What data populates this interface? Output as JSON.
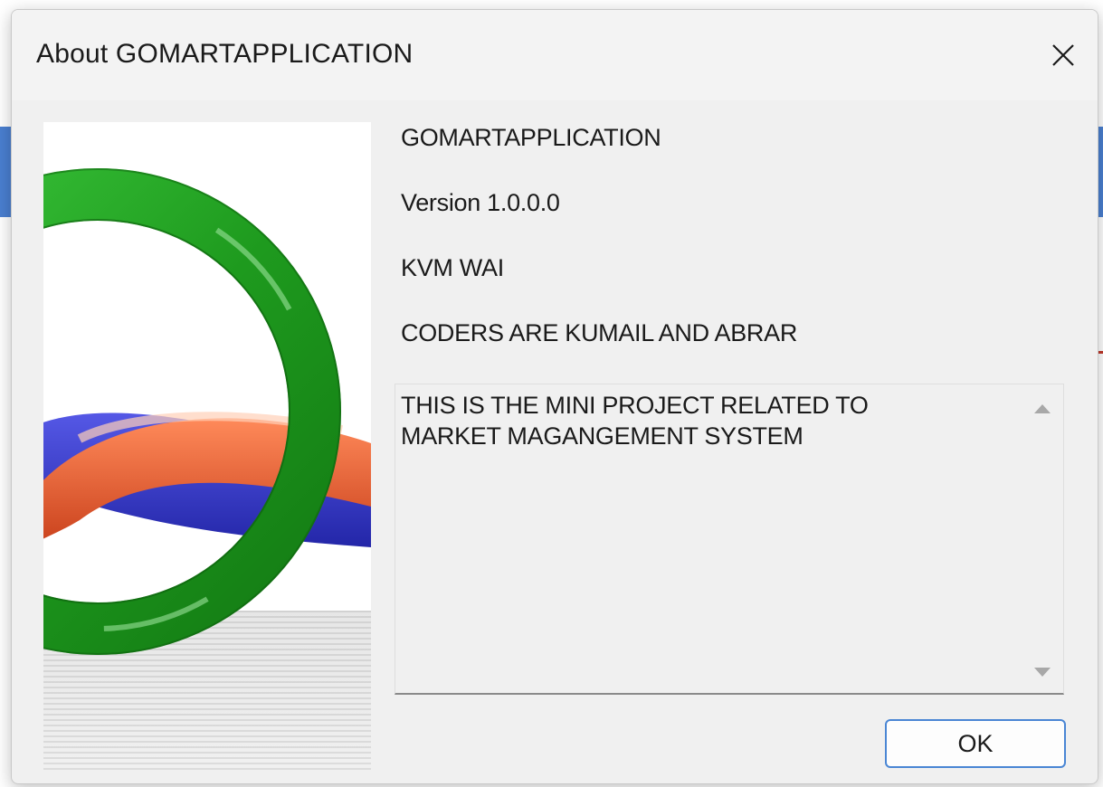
{
  "window": {
    "title": "About GOMARTAPPLICATION",
    "close_icon": "close-icon"
  },
  "about": {
    "product_name": "GOMARTAPPLICATION",
    "version": "Version 1.0.0.0",
    "company": "KVM WAI",
    "copyright": "CODERS ARE KUMAIL  AND ABRAR",
    "description": "THIS IS THE MINI PROJECT RELATED TO\nMARKET MAGANGEMENT SYSTEM"
  },
  "buttons": {
    "ok_label": "OK"
  },
  "logo": {
    "icon": "interlocking-rings-logo",
    "colors": {
      "green": "#2fa52f",
      "blue": "#3b3fd0",
      "orange": "#e0572a"
    }
  },
  "colors": {
    "dialog_bg": "#f0f0f0",
    "accent_border": "#4a86d4"
  }
}
